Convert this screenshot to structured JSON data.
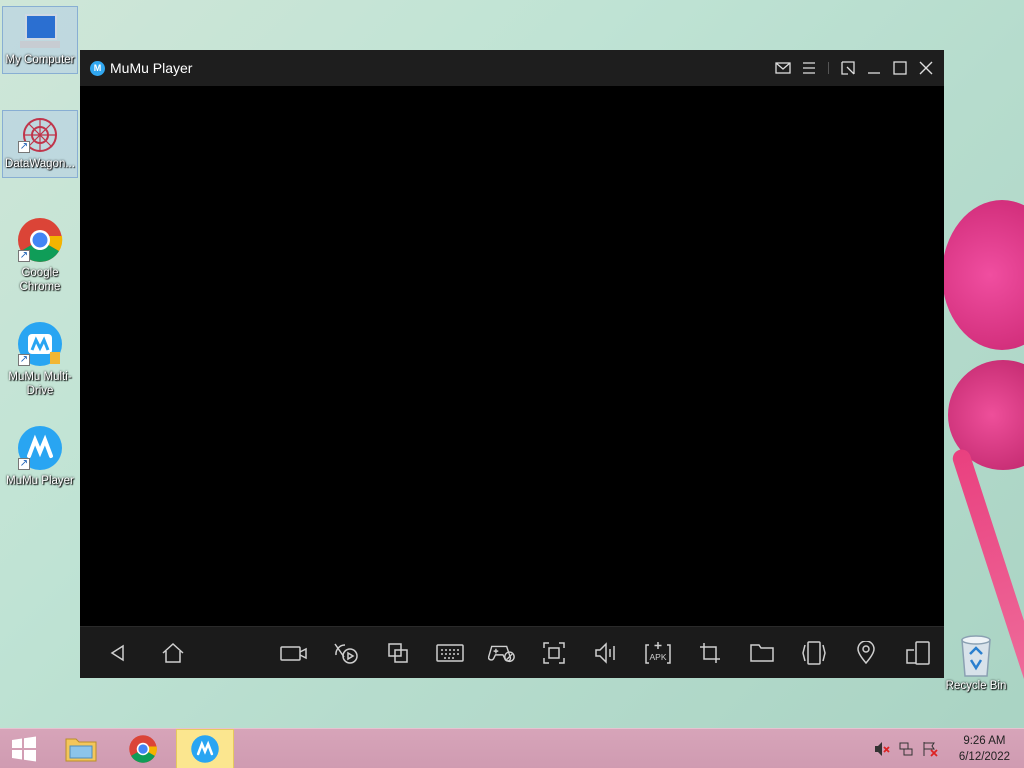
{
  "desktop": {
    "icons": [
      {
        "label": "My Computer"
      },
      {
        "label": "DataWagon..."
      },
      {
        "label": "Google Chrome"
      },
      {
        "label": "MuMu Multi-Drive"
      },
      {
        "label": "MuMu Player"
      }
    ],
    "recycle_bin": {
      "label": "Recycle Bin"
    }
  },
  "window": {
    "title": "MuMu Player",
    "title_controls": [
      "mail-icon",
      "menu-icon",
      "pin-icon",
      "minimize-icon",
      "maximize-icon",
      "close-icon"
    ],
    "toolbar": [
      "back-icon",
      "home-icon",
      "video-record-icon",
      "operation-record-icon",
      "multi-window-icon",
      "keyboard-icon",
      "gamepad-icon",
      "fullscreen-icon",
      "volume-icon",
      "install-apk-icon",
      "crop-icon",
      "folder-icon",
      "shake-icon",
      "location-icon",
      "rotate-icon"
    ]
  },
  "taskbar": {
    "apps": [
      "file-explorer-icon",
      "chrome-icon",
      "mumu-player-icon"
    ],
    "clock": {
      "time": "9:26 AM",
      "date": "6/12/2022"
    }
  },
  "colors": {
    "titlebar": "#1e1e1e",
    "toolbar": "#1b1b1b",
    "taskbar": "#d7a4b9",
    "mumu_blue": "#31a7f0"
  }
}
